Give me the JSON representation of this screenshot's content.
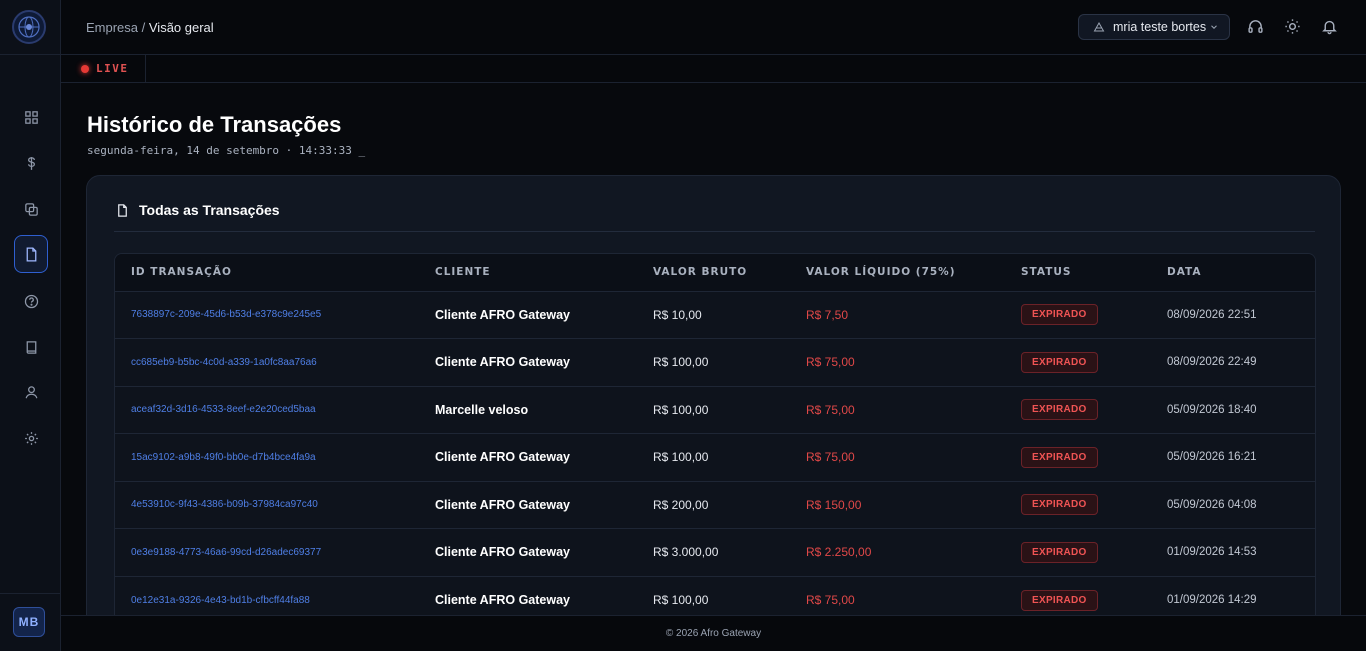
{
  "header": {
    "breadcrumb_parent": "Empresa",
    "breadcrumb_sep": " / ",
    "breadcrumb_current": "Visão geral",
    "user_name": "mria teste bortes"
  },
  "live": {
    "label": "LIVE"
  },
  "page": {
    "title": "Histórico de Transações",
    "subtitle": "segunda-feira, 14 de setembro · 14:33:33 _"
  },
  "card": {
    "title": "Todas as Transações"
  },
  "table": {
    "headers": [
      "ID TRANSAÇÃO",
      "CLIENTE",
      "VALOR BRUTO",
      "VALOR LÍQUIDO (75%)",
      "STATUS",
      "DATA"
    ],
    "rows": [
      {
        "id": "7638897c-209e-45d6-b53d-e378c9e245e5",
        "client": "Cliente AFRO Gateway",
        "gross": "R$ 10,00",
        "net": "R$ 7,50",
        "status": "EXPIRADO",
        "date": "08/09/2026 22:51"
      },
      {
        "id": "cc685eb9-b5bc-4c0d-a339-1a0fc8aa76a6",
        "client": "Cliente AFRO Gateway",
        "gross": "R$ 100,00",
        "net": "R$ 75,00",
        "status": "EXPIRADO",
        "date": "08/09/2026 22:49"
      },
      {
        "id": "aceaf32d-3d16-4533-8eef-e2e20ced5baa",
        "client": "Marcelle veloso",
        "gross": "R$ 100,00",
        "net": "R$ 75,00",
        "status": "EXPIRADO",
        "date": "05/09/2026 18:40"
      },
      {
        "id": "15ac9102-a9b8-49f0-bb0e-d7b4bce4fa9a",
        "client": "Cliente AFRO Gateway",
        "gross": "R$ 100,00",
        "net": "R$ 75,00",
        "status": "EXPIRADO",
        "date": "05/09/2026 16:21"
      },
      {
        "id": "4e53910c-9f43-4386-b09b-37984ca97c40",
        "client": "Cliente AFRO Gateway",
        "gross": "R$ 200,00",
        "net": "R$ 150,00",
        "status": "EXPIRADO",
        "date": "05/09/2026 04:08"
      },
      {
        "id": "0e3e9188-4773-46a6-99cd-d26adec69377",
        "client": "Cliente AFRO Gateway",
        "gross": "R$ 3.000,00",
        "net": "R$ 2.250,00",
        "status": "EXPIRADO",
        "date": "01/09/2026 14:53"
      },
      {
        "id": "0e12e31a-9326-4e43-bd1b-cfbcff44fa88",
        "client": "Cliente AFRO Gateway",
        "gross": "R$ 100,00",
        "net": "R$ 75,00",
        "status": "EXPIRADO",
        "date": "01/09/2026 14:29"
      }
    ]
  },
  "sidebar": {
    "items": [
      {
        "icon": "grid-icon"
      },
      {
        "icon": "dollar-icon"
      },
      {
        "icon": "transfer-icon"
      },
      {
        "icon": "document-icon",
        "active": true
      },
      {
        "icon": "help-icon"
      },
      {
        "icon": "book-icon"
      },
      {
        "icon": "user-icon"
      },
      {
        "icon": "gear-icon"
      }
    ],
    "avatar_initials": "MB"
  },
  "footer": {
    "text": "© 2026 Afro Gateway"
  },
  "colors": {
    "accent": "#2f5fd0",
    "danger": "#e04848",
    "link": "#4f7fe6",
    "live": "#e53935"
  }
}
